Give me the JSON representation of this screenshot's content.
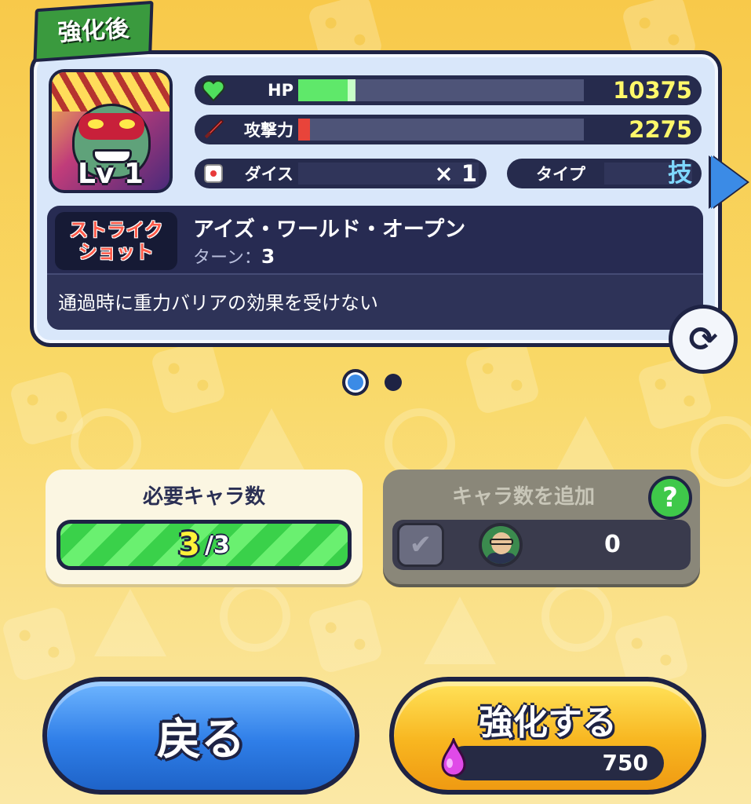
{
  "header": {
    "tag_label": "強化後"
  },
  "character": {
    "level_label": "Lv 1"
  },
  "stats": {
    "hp": {
      "label": "HP",
      "value": "10375",
      "fill_fraction": 0.2
    },
    "attack": {
      "label": "攻撃力",
      "value": "2275",
      "fill_fraction": 0.04
    },
    "dice": {
      "label": "ダイス",
      "value": "× 1"
    },
    "type": {
      "label": "タイプ",
      "value": "技"
    }
  },
  "skill": {
    "badge_line1": "ストライク",
    "badge_line2": "ショット",
    "name": "アイズ・ワールド・オープン",
    "turn_label": "ターン：",
    "turn_value": "3",
    "description": "通過時に重力バリアの効果を受けない"
  },
  "pagination": {
    "total": 2,
    "current": 1
  },
  "required": {
    "title": "必要キャラ数",
    "count": "3",
    "total": "/3"
  },
  "add": {
    "title": "キャラ数を追加",
    "help_symbol": "?",
    "count": "0"
  },
  "buttons": {
    "back_label": "戻る",
    "enhance_label": "強化する",
    "cost_value": "750"
  },
  "colors": {
    "accent_blue": "#3b8be6",
    "hp_green": "#5fe86a",
    "attack_red": "#e8443a",
    "value_yellow": "#fff86a"
  },
  "icons": [
    "heart-icon",
    "sword-icon",
    "dice-icon",
    "next-arrow-icon",
    "swap-icon",
    "help-icon",
    "check-icon",
    "character-icon",
    "gem-icon"
  ]
}
